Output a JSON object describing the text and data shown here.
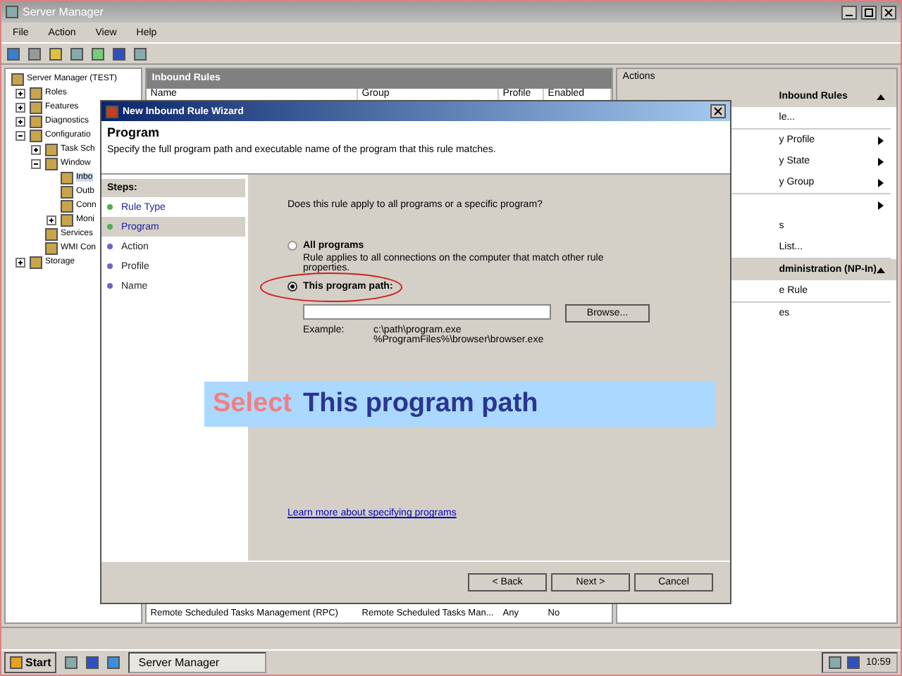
{
  "window": {
    "title": "Server Manager"
  },
  "menu": [
    "File",
    "Action",
    "View",
    "Help"
  ],
  "tree": [
    {
      "label": "Server Manager (TEST)",
      "children": [
        {
          "label": "Roles",
          "expanded": false
        },
        {
          "label": "Features",
          "expanded": false
        },
        {
          "label": "Diagnostics",
          "expanded": false
        },
        {
          "label": "Configuratio",
          "expanded": true,
          "children": [
            {
              "label": "Task Sch",
              "expanded": false
            },
            {
              "label": "Window",
              "expanded": true,
              "children": [
                {
                  "label": "Inbo",
                  "selected": true
                },
                {
                  "label": "Outb",
                  "selected": false
                },
                {
                  "label": "Conn",
                  "selected": false
                },
                {
                  "label": "Moni",
                  "expanded": false
                }
              ]
            },
            {
              "label": "Services"
            },
            {
              "label": "WMI Con"
            }
          ]
        },
        {
          "label": "Storage",
          "expanded": false
        }
      ]
    }
  ],
  "rules_panel": {
    "title": "Inbound Rules",
    "columns": [
      "Name",
      "Group",
      "Profile",
      "Enabled"
    ],
    "rows": [
      [
        "Remote Scheduled Tasks Management (RPC)",
        "Remote Scheduled Tasks Man...",
        "Any",
        "No"
      ]
    ]
  },
  "actions": {
    "title": "Actions",
    "items": [
      {
        "kind": "heading",
        "label": "Inbound Rules"
      },
      {
        "kind": "item",
        "label": "le..."
      },
      {
        "kind": "sep"
      },
      {
        "kind": "submenu",
        "label": "y Profile"
      },
      {
        "kind": "submenu",
        "label": "y State"
      },
      {
        "kind": "submenu",
        "label": "y Group"
      },
      {
        "kind": "sep"
      },
      {
        "kind": "arrow"
      },
      {
        "kind": "item",
        "label": "s"
      },
      {
        "kind": "item",
        "label": "List..."
      },
      {
        "kind": "sep"
      },
      {
        "kind": "heading",
        "label": "dministration (NP-In)"
      },
      {
        "kind": "item",
        "label": "e Rule"
      },
      {
        "kind": "sep"
      },
      {
        "kind": "item",
        "label": "es"
      }
    ]
  },
  "dialog": {
    "title": "New Inbound Rule Wizard",
    "heading": "Program",
    "subtitle": "Specify the full program path and executable name of the program that this rule matches.",
    "steps_title": "Steps:",
    "steps": [
      {
        "label": "Rule Type",
        "selected": false,
        "done": true
      },
      {
        "label": "Program",
        "selected": true,
        "done": true
      },
      {
        "label": "Action",
        "selected": false,
        "done": false
      },
      {
        "label": "Profile",
        "selected": false,
        "done": false
      },
      {
        "label": "Name",
        "selected": false,
        "done": false
      }
    ],
    "question": "Does this rule apply to all programs or a specific program?",
    "options": [
      {
        "label": "All programs",
        "description": "Rule applies to all connections on the computer that match other rule properties.",
        "selected": false
      },
      {
        "label": "This program path:",
        "selected": true
      }
    ],
    "browse": "Browse...",
    "example_label": "Example:",
    "examples": [
      "c:\\path\\program.exe",
      "%ProgramFiles%\\browser\\browser.exe"
    ],
    "link": "Learn more about specifying programs",
    "buttons": [
      "< Back",
      "Next >",
      "Cancel"
    ]
  },
  "callout": {
    "lead": "Select",
    "text": "This program path"
  },
  "taskbar": {
    "start": "Start",
    "task": "Server Manager",
    "clock": "10:59"
  }
}
